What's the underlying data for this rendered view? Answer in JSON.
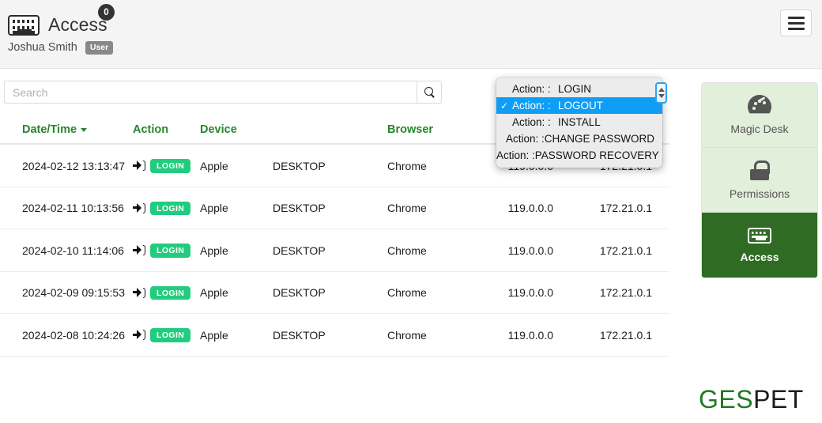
{
  "header": {
    "app_title": "Access",
    "badge_count": "0",
    "user_name": "Joshua Smith",
    "user_role": "User",
    "keyboard_icon": "keyboard-icon",
    "menu_icon": "hamburger-menu-icon"
  },
  "search": {
    "placeholder": "Search",
    "value": "",
    "button_icon": "search-icon"
  },
  "action_filter": {
    "label": "Action: :",
    "selected": "LOGOUT",
    "options": [
      {
        "label": "Action: :",
        "value": "LOGIN",
        "selected": false
      },
      {
        "label": "Action: :",
        "value": "LOGOUT",
        "selected": true
      },
      {
        "label": "Action: :",
        "value": "INSTALL",
        "selected": false
      },
      {
        "label": "Action: :",
        "value": "CHANGE PASSWORD",
        "selected": false
      },
      {
        "label": "Action: :",
        "value": "PASSWORD RECOVERY",
        "selected": false
      }
    ]
  },
  "table": {
    "columns": [
      "Date/Time",
      "Action",
      "Device",
      "",
      "Browser",
      "",
      ""
    ],
    "sorted_column": "Date/Time",
    "rows": [
      {
        "datetime": "2024-02-12 13:13:47",
        "action": "LOGIN",
        "device": "Apple",
        "device_type": "DESKTOP",
        "browser": "Chrome",
        "ip_public": "119.0.0.0",
        "ip_local": "172.21.0.1"
      },
      {
        "datetime": "2024-02-11 10:13:56",
        "action": "LOGIN",
        "device": "Apple",
        "device_type": "DESKTOP",
        "browser": "Chrome",
        "ip_public": "119.0.0.0",
        "ip_local": "172.21.0.1"
      },
      {
        "datetime": "2024-02-10 11:14:06",
        "action": "LOGIN",
        "device": "Apple",
        "device_type": "DESKTOP",
        "browser": "Chrome",
        "ip_public": "119.0.0.0",
        "ip_local": "172.21.0.1"
      },
      {
        "datetime": "2024-02-09 09:15:53",
        "action": "LOGIN",
        "device": "Apple",
        "device_type": "DESKTOP",
        "browser": "Chrome",
        "ip_public": "119.0.0.0",
        "ip_local": "172.21.0.1"
      },
      {
        "datetime": "2024-02-08 10:24:26",
        "action": "LOGIN",
        "device": "Apple",
        "device_type": "DESKTOP",
        "browser": "Chrome",
        "ip_public": "119.0.0.0",
        "ip_local": "172.21.0.1"
      }
    ]
  },
  "sidebar": {
    "items": [
      {
        "label": "Magic Desk",
        "icon": "gauge-icon",
        "active": false
      },
      {
        "label": "Permissions",
        "icon": "lock-icon",
        "active": false
      },
      {
        "label": "Access",
        "icon": "keyboard-icon",
        "active": true
      }
    ]
  },
  "logo": {
    "part1": "GES",
    "part2": "PET"
  },
  "colors": {
    "header_green": "#27862c",
    "badge_green": "#22cc7e",
    "sidebar_light": "#e2efdb",
    "sidebar_active": "#2f6b23",
    "select_highlight": "#0f9ef5",
    "logo_green": "#1f7a1f"
  }
}
